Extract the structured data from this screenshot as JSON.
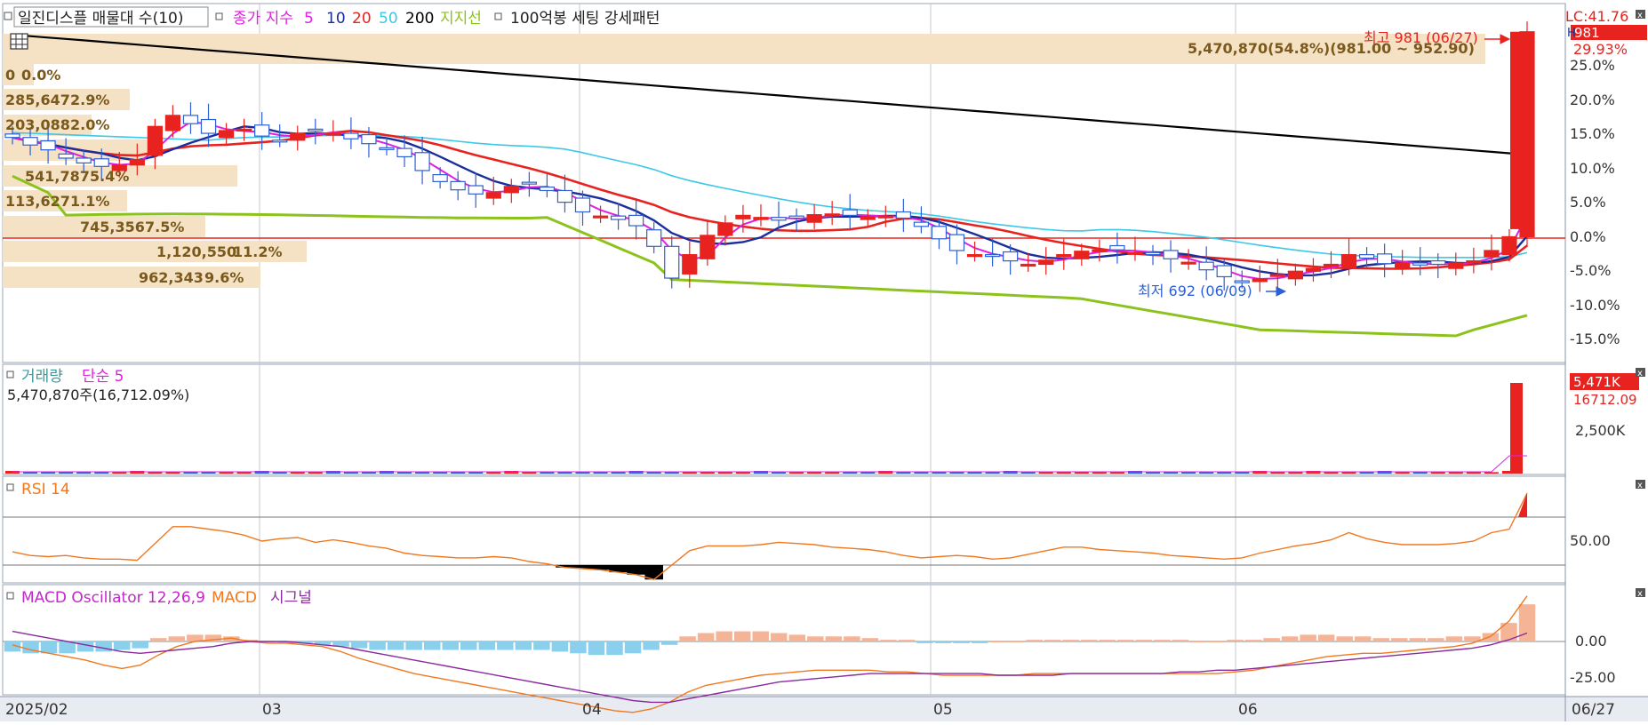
{
  "legend": {
    "main": {
      "stock_name": "일진디스플 매물대 수(10)",
      "price_label": "종가 지수",
      "ma_periods": [
        "5",
        "10",
        "20",
        "50",
        "200"
      ],
      "support_label": "지지선",
      "pattern_label": "100억봉 세팅 강세패턴"
    },
    "volume": {
      "title": "거래량",
      "ma_label": "단순 5",
      "info": "5,470,870주(16,712.09%)"
    },
    "rsi": {
      "title": "RSI 14"
    },
    "macd": {
      "title": "MACD Oscillator 12,26,9",
      "macd_label": "MACD",
      "signal_label": "시그널"
    }
  },
  "annotations": {
    "high_text": "최고 981 (06/27)",
    "low_text": "최저 692 (06/09)",
    "top_bar_text": "5,470,870(54.8%)(981.00 ~ 952.90)",
    "lc_text": "LC:41.76",
    "h_price": "981",
    "h_pct": "29.93%",
    "h_prefix": "H",
    "vol_now": "5,471K",
    "vol_pct": "16712.09",
    "icon_name": "grid-icon",
    "close_icon": "close-icon"
  },
  "colors": {
    "up": "#e8231f",
    "down": "#2e5fd4",
    "ma5": "#e020e0",
    "ma10": "#1a2e9c",
    "ma20": "#e8231f",
    "ma50": "#3cc8e8",
    "ma200": "#000000",
    "support": "#8cc21c",
    "profile": "#f5e1c4",
    "profile_text": "#7a5a1c",
    "rsi": "#f07820",
    "macd_line": "#f07820",
    "signal_line": "#8a2a9e",
    "osc_pos": "#f5b496",
    "osc_neg": "#8ad0ec"
  },
  "chart_data": [
    {
      "type": "candlestick",
      "title": "일진디스플 매물대 수(10)",
      "y_axis_ticks": [
        "25.0%",
        "20.0%",
        "15.0%",
        "10.0%",
        "5.0%",
        "0.0%",
        "-5.0%",
        "-10.0%",
        "-15.0%"
      ],
      "y_axis_pct_range": [
        -17.4,
        29.93
      ],
      "x_labels": [
        "2025/02",
        "03",
        "04",
        "05",
        "06",
        "06/27"
      ],
      "reference_price": 755,
      "high": {
        "price": 981,
        "date": "06/27"
      },
      "low": {
        "price": 692,
        "date": "06/09"
      },
      "price_series_pct": [
        14.6,
        13.5,
        12.8,
        11.6,
        10.9,
        10.4,
        10.6,
        11.4,
        16.2,
        17.8,
        16.6,
        15.2,
        15.6,
        15.8,
        14.8,
        14.2,
        15.2,
        15.6,
        15.2,
        14.4,
        13.7,
        13.0,
        11.8,
        9.8,
        8.2,
        7.0,
        6.4,
        6.6,
        7.5,
        8.0,
        6.9,
        5.2,
        3.8,
        3.2,
        2.7,
        1.8,
        -1.2,
        -5.8,
        -2.4,
        0.4,
        2.2,
        3.3,
        3.0,
        2.6,
        2.9,
        3.4,
        3.5,
        3.3,
        3.1,
        3.2,
        2.9,
        1.7,
        -0.1,
        -1.8,
        -2.4,
        -2.6,
        -3.3,
        -3.8,
        -3.2,
        -2.4,
        -1.9,
        -1.7,
        -1.7,
        -2.1,
        -2.4,
        -3.0,
        -3.5,
        -4.6,
        -5.6,
        -6.3,
        -5.9,
        -5.3,
        -4.8,
        -4.4,
        -3.8,
        -2.4,
        -2.9,
        -3.7,
        -3.6,
        -3.9,
        -3.8,
        -3.6,
        -3.3,
        -1.8,
        0.2,
        29.93
      ],
      "ma_periods": [
        5,
        10,
        20,
        50,
        200
      ],
      "volume_profile": [
        {
          "volume": "0",
          "pct": "0.0%"
        },
        {
          "volume": "285,647",
          "pct": "2.9%"
        },
        {
          "volume": "203,088",
          "pct": "2.0%"
        },
        {
          "volume": "541,787",
          "pct": "5.4%"
        },
        {
          "volume": "113,627",
          "pct": "1.1%"
        },
        {
          "volume": "745,356",
          "pct": "7.5%"
        },
        {
          "volume": "1,120,550",
          "pct": "11.2%"
        },
        {
          "volume": "962,343",
          "pct": "9.6%"
        }
      ]
    },
    {
      "type": "bar",
      "title": "거래량",
      "y_axis_ticks": [
        "2,500K"
      ],
      "last_volume": 5470870,
      "last_volume_ratio_pct": 16712.09,
      "note": "earlier daily volumes are near-zero relative to the last bar"
    },
    {
      "type": "line",
      "title": "RSI 14",
      "y_axis_ticks": [
        "50.00"
      ],
      "ylim": [
        0,
        100
      ],
      "upper_line": 70,
      "lower_line": 30,
      "values": [
        41,
        38,
        37,
        38,
        36,
        35,
        35,
        34,
        48,
        62,
        62,
        60,
        58,
        55,
        50,
        52,
        53,
        49,
        51,
        49,
        46,
        44,
        40,
        38,
        37,
        36,
        36,
        37,
        36,
        33,
        31,
        28,
        27,
        26,
        24,
        22,
        18,
        30,
        42,
        46,
        46,
        46,
        47,
        49,
        48,
        47,
        45,
        44,
        43,
        41,
        38,
        36,
        37,
        38,
        37,
        35,
        36,
        39,
        42,
        45,
        45,
        43,
        42,
        41,
        40,
        38,
        37,
        36,
        35,
        36,
        40,
        43,
        46,
        48,
        51,
        57,
        52,
        49,
        47,
        47,
        47,
        48,
        50,
        57,
        60,
        90
      ]
    },
    {
      "type": "line",
      "title": "MACD Oscillator 12,26,9",
      "y_axis_ticks": [
        "0.00",
        "-25.00"
      ],
      "ylim": [
        -42,
        30
      ],
      "macd": [
        -2,
        -5,
        -7,
        -9,
        -11,
        -14,
        -16,
        -14,
        -8,
        -3,
        0,
        1,
        2,
        0,
        -1,
        -1,
        -2,
        -3,
        -6,
        -10,
        -13,
        -16,
        -19,
        -21,
        -23,
        -25,
        -27,
        -29,
        -31,
        -33,
        -35,
        -37,
        -39,
        -41,
        -42,
        -40,
        -36,
        -30,
        -26,
        -24,
        -22,
        -20,
        -19,
        -18,
        -17,
        -17,
        -17,
        -17,
        -18,
        -18,
        -19,
        -20,
        -20,
        -20,
        -20,
        -20,
        -19,
        -19,
        -19,
        -19,
        -19,
        -19,
        -19,
        -19,
        -19,
        -19,
        -19,
        -18,
        -17,
        -15,
        -13,
        -11,
        -9,
        -8,
        -7,
        -7,
        -6,
        -5,
        -4,
        -3,
        -1,
        3,
        12,
        27
      ],
      "signal": [
        6,
        4,
        2,
        0,
        -2,
        -4,
        -6,
        -7,
        -6,
        -5,
        -4,
        -3,
        -1,
        0,
        0,
        0,
        -1,
        -2,
        -3,
        -5,
        -7,
        -9,
        -11,
        -13,
        -15,
        -17,
        -19,
        -21,
        -23,
        -25,
        -27,
        -29,
        -31,
        -33,
        -35,
        -36,
        -36,
        -34,
        -32,
        -30,
        -28,
        -26,
        -24,
        -23,
        -22,
        -21,
        -20,
        -19,
        -19,
        -19,
        -19,
        -19,
        -19,
        -19,
        -20,
        -20,
        -20,
        -20,
        -19,
        -19,
        -19,
        -19,
        -19,
        -19,
        -18,
        -18,
        -17,
        -17,
        -16,
        -15,
        -14,
        -13,
        -12,
        -11,
        -10,
        -9,
        -8,
        -7,
        -6,
        -5,
        -4,
        -2,
        1,
        5
      ],
      "oscillator": [
        -6,
        -7,
        -7,
        -7,
        -6,
        -6,
        -5,
        -4,
        2,
        3,
        4,
        4,
        3,
        1,
        0,
        -1,
        -1,
        -2,
        -3,
        -4,
        -5,
        -5,
        -5,
        -5,
        -5,
        -5,
        -5,
        -5,
        -5,
        -5,
        -6,
        -7,
        -8,
        -8,
        -7,
        -5,
        -2,
        3,
        5,
        6,
        6,
        6,
        5,
        4,
        3,
        3,
        3,
        2,
        1,
        1,
        -1,
        -1,
        -1,
        -1,
        0,
        0,
        1,
        1,
        1,
        1,
        1,
        1,
        1,
        1,
        1,
        0,
        0,
        1,
        1,
        2,
        3,
        4,
        4,
        3,
        3,
        2,
        2,
        2,
        2,
        3,
        3,
        5,
        11,
        22
      ]
    }
  ]
}
